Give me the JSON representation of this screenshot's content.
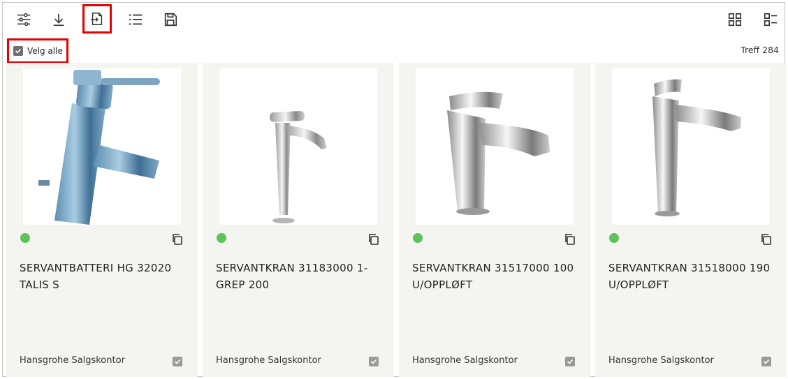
{
  "toolbar": {
    "buttons": [
      {
        "icon": "sliders-icon"
      },
      {
        "icon": "download-icon"
      },
      {
        "icon": "export-icon"
      },
      {
        "icon": "list-icon"
      },
      {
        "icon": "save-icon"
      }
    ],
    "view_buttons": [
      {
        "icon": "grid-view-icon"
      },
      {
        "icon": "list-view-icon"
      }
    ]
  },
  "select_all": {
    "label": "Velg alle",
    "checked": true
  },
  "hits": {
    "label": "Treff 284"
  },
  "accent_colors": {
    "highlight": "#e30000",
    "status": "#5cc35c"
  },
  "products": [
    {
      "title": "SERVANTBATTERI HG 32020 TALIS S",
      "vendor": "Hansgrohe Salgskontor",
      "status": "green",
      "checked": true
    },
    {
      "title": "SERVANTKRAN 31183000 1-GREP 200",
      "vendor": "Hansgrohe Salgskontor",
      "status": "green",
      "checked": true
    },
    {
      "title": "SERVANTKRAN 31517000 100 U/OPPLØFT",
      "vendor": "Hansgrohe Salgskontor",
      "status": "green",
      "checked": true
    },
    {
      "title": "SERVANTKRAN 31518000 190 U/OPPLØFT",
      "vendor": "Hansgrohe Salgskontor",
      "status": "green",
      "checked": true
    }
  ]
}
